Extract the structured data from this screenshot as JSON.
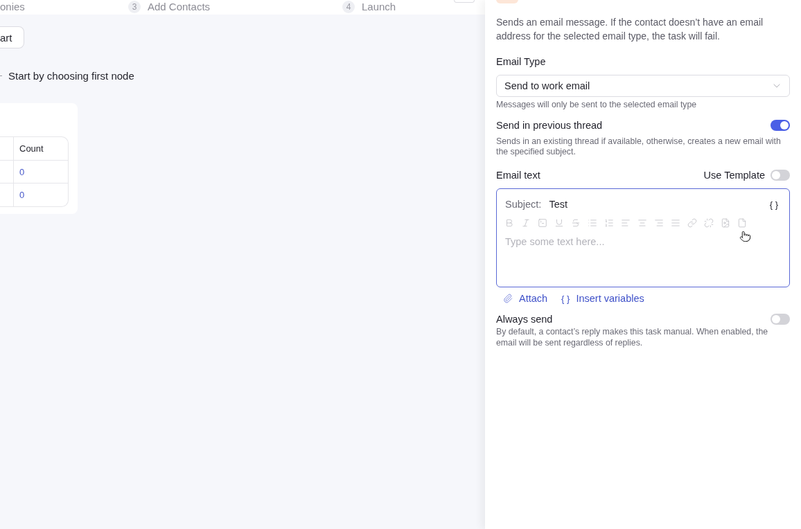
{
  "header": {
    "steps": [
      {
        "label": "onies"
      },
      {
        "number": "3",
        "label": "Add Contacts"
      },
      {
        "number": "4",
        "label": "Launch"
      }
    ]
  },
  "canvas": {
    "start_button": "art",
    "hint": "Start by choosing first node",
    "table": {
      "columns": [
        "Count"
      ],
      "rows": [
        [
          "0"
        ],
        [
          "0"
        ]
      ]
    }
  },
  "panel": {
    "description": "Sends an email message. If the contact doesn’t have an email address for the selected email type, the task will fail.",
    "email_type": {
      "label": "Email Type",
      "value": "Send to work email",
      "hint": "Messages will only be sent to the selected email type"
    },
    "send_in_previous_thread": {
      "label": "Send in previous thread",
      "on": true,
      "hint": "Sends in an existing thread if available, otherwise, creates a new email with the specified subject."
    },
    "email_text": {
      "label": "Email text",
      "use_template": {
        "label": "Use Template",
        "on": false
      },
      "subject_label": "Subject:",
      "subject": "Test",
      "variables_glyph": "{ }",
      "toolbar_disabled": true,
      "placeholder": "Type some text here..."
    },
    "actions": [
      {
        "kind": "attach",
        "label": "Attach"
      },
      {
        "kind": "variables",
        "glyph": "{ }",
        "label": "Insert variables"
      }
    ],
    "always_send": {
      "label": "Always send",
      "on": false,
      "hint": "By default, a contact’s reply makes this task manual. When enabled, the email will be sent regardless of replies."
    }
  }
}
